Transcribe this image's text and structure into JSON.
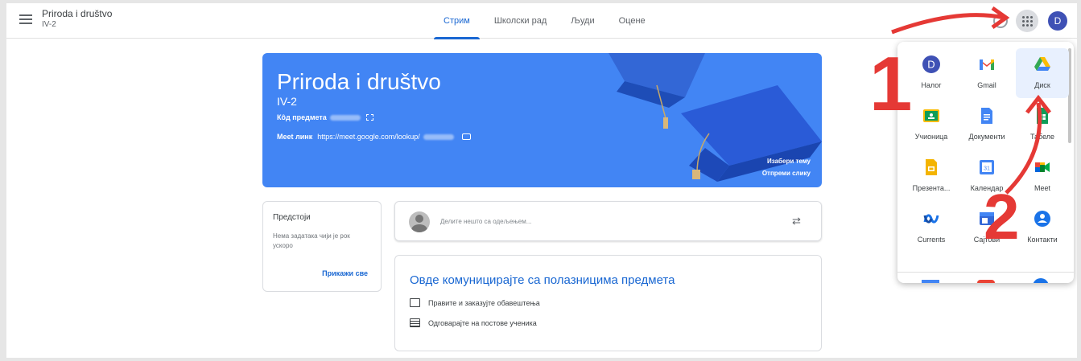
{
  "header": {
    "class_name": "Priroda i društvo",
    "class_section": "IV-2",
    "tabs": [
      {
        "label": "Стрим",
        "active": true
      },
      {
        "label": "Школски рад",
        "active": false
      },
      {
        "label": "Људи",
        "active": false
      },
      {
        "label": "Оцене",
        "active": false
      }
    ],
    "avatar_letter": "D"
  },
  "banner": {
    "title": "Priroda i društvo",
    "section": "IV-2",
    "code_label": "Кôд предмета",
    "meet_label": "Meet линк",
    "meet_url": "https://meet.google.com/lookup/",
    "select_theme": "Изабери тему",
    "upload_photo": "Отпреми слику",
    "color": "#4285f4"
  },
  "upcoming": {
    "title": "Предстоји",
    "empty_text": "Нема задатака чији је рок ускоро",
    "view_all": "Прикажи све"
  },
  "announce": {
    "placeholder": "Делите нешто са одељењем..."
  },
  "communicate": {
    "title": "Овде комуницирајте са полазницима предмета",
    "items": [
      {
        "label": "Правите и заказујте обавештења",
        "icon": "announcement-icon"
      },
      {
        "label": "Одговарајте на постове ученика",
        "icon": "reply-icon"
      }
    ]
  },
  "apps_menu": {
    "apps": [
      {
        "label": "Налог",
        "icon": "account-icon"
      },
      {
        "label": "Gmail",
        "icon": "gmail-icon"
      },
      {
        "label": "Диск",
        "icon": "drive-icon",
        "selected": true
      },
      {
        "label": "Учионица",
        "icon": "classroom-icon"
      },
      {
        "label": "Документи",
        "icon": "docs-icon"
      },
      {
        "label": "Табеле",
        "icon": "sheets-icon"
      },
      {
        "label": "Презента...",
        "icon": "slides-icon"
      },
      {
        "label": "Календар",
        "icon": "calendar-icon"
      },
      {
        "label": "Meet",
        "icon": "meet-icon"
      },
      {
        "label": "Currents",
        "icon": "currents-icon"
      },
      {
        "label": "Сајтови",
        "icon": "sites-icon"
      },
      {
        "label": "Контакти",
        "icon": "contacts-icon"
      }
    ],
    "calendar_day": "31",
    "account_letter": "D"
  },
  "annotations": {
    "step_1": "1",
    "step_2": "2",
    "color": "#e53935"
  }
}
